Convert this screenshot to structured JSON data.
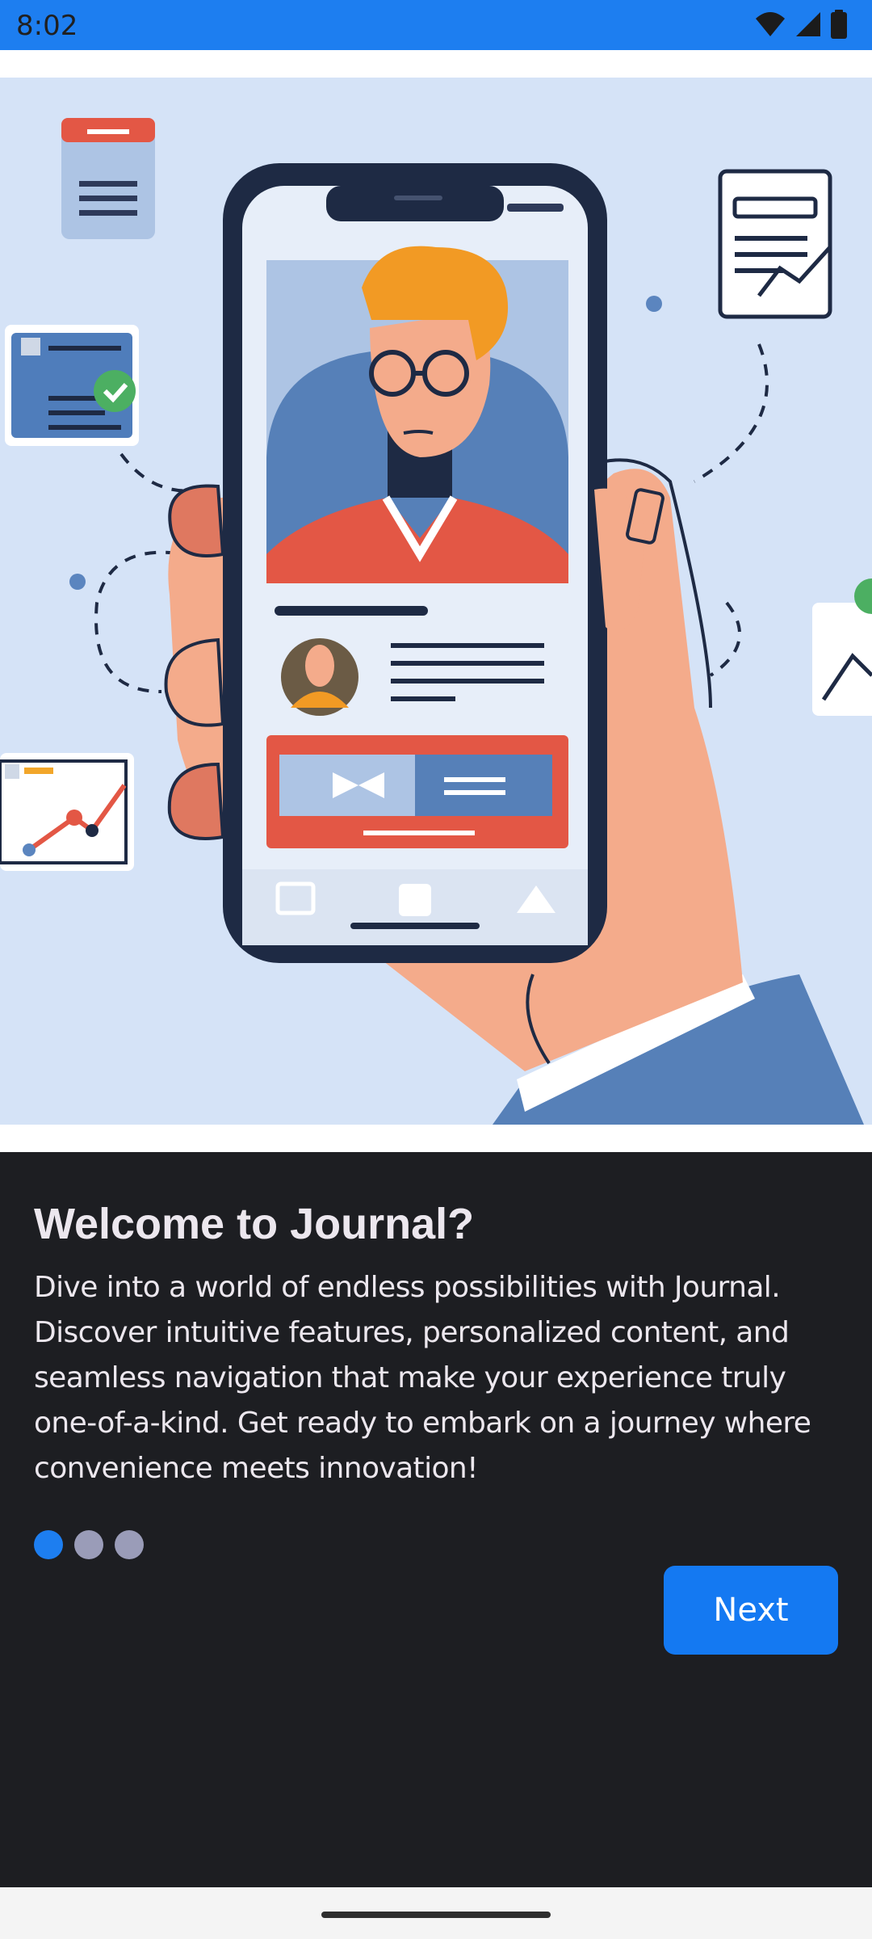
{
  "status_bar": {
    "time": "8:02",
    "icons": [
      "wifi-icon",
      "signal-icon",
      "battery-icon"
    ],
    "color": "#1d7ef0"
  },
  "onboarding": {
    "title": "Welcome to Journal?",
    "description": "Dive into a world of endless possibilities with Journal. Discover intuitive features, personalized content, and seamless navigation that make your experience truly one-of-a-kind. Get ready to embark on a journey where convenience meets innovation!",
    "page_indicator": {
      "total": 3,
      "current": 1
    },
    "next_label": "Next"
  },
  "colors": {
    "panel_background": "#1d1e22",
    "accent": "#1479f2",
    "inactive_dot": "#9a9cb8",
    "illustration_background": "#d5e3f7"
  }
}
